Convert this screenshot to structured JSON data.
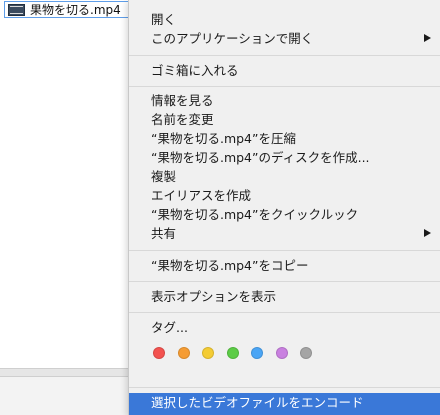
{
  "finder": {
    "file_name": "果物を切る.mp4"
  },
  "menu": {
    "open": "開く",
    "open_with": "このアプリケーションで開く",
    "move_to_trash": "ゴミ箱に入れる",
    "get_info": "情報を見る",
    "rename": "名前を変更",
    "compress": "“果物を切る.mp4”を圧縮",
    "burn_disc": "“果物を切る.mp4”のディスクを作成...",
    "duplicate": "複製",
    "make_alias": "エイリアスを作成",
    "quick_look": "“果物を切る.mp4”をクイックルック",
    "share": "共有",
    "copy": "“果物を切る.mp4”をコピー",
    "show_view_options": "表示オプションを表示",
    "tags": "タグ...",
    "tag_colors": [
      {
        "name": "red-tag",
        "color": "#f3524f"
      },
      {
        "name": "orange-tag",
        "color": "#f59c33"
      },
      {
        "name": "yellow-tag",
        "color": "#f4cc34"
      },
      {
        "name": "green-tag",
        "color": "#5ccc46"
      },
      {
        "name": "blue-tag",
        "color": "#4aa5f5"
      },
      {
        "name": "purple-tag",
        "color": "#c980e0"
      },
      {
        "name": "gray-tag",
        "color": "#a5a5a5"
      }
    ],
    "encode_video": "選択したビデオファイルをエンコード"
  }
}
